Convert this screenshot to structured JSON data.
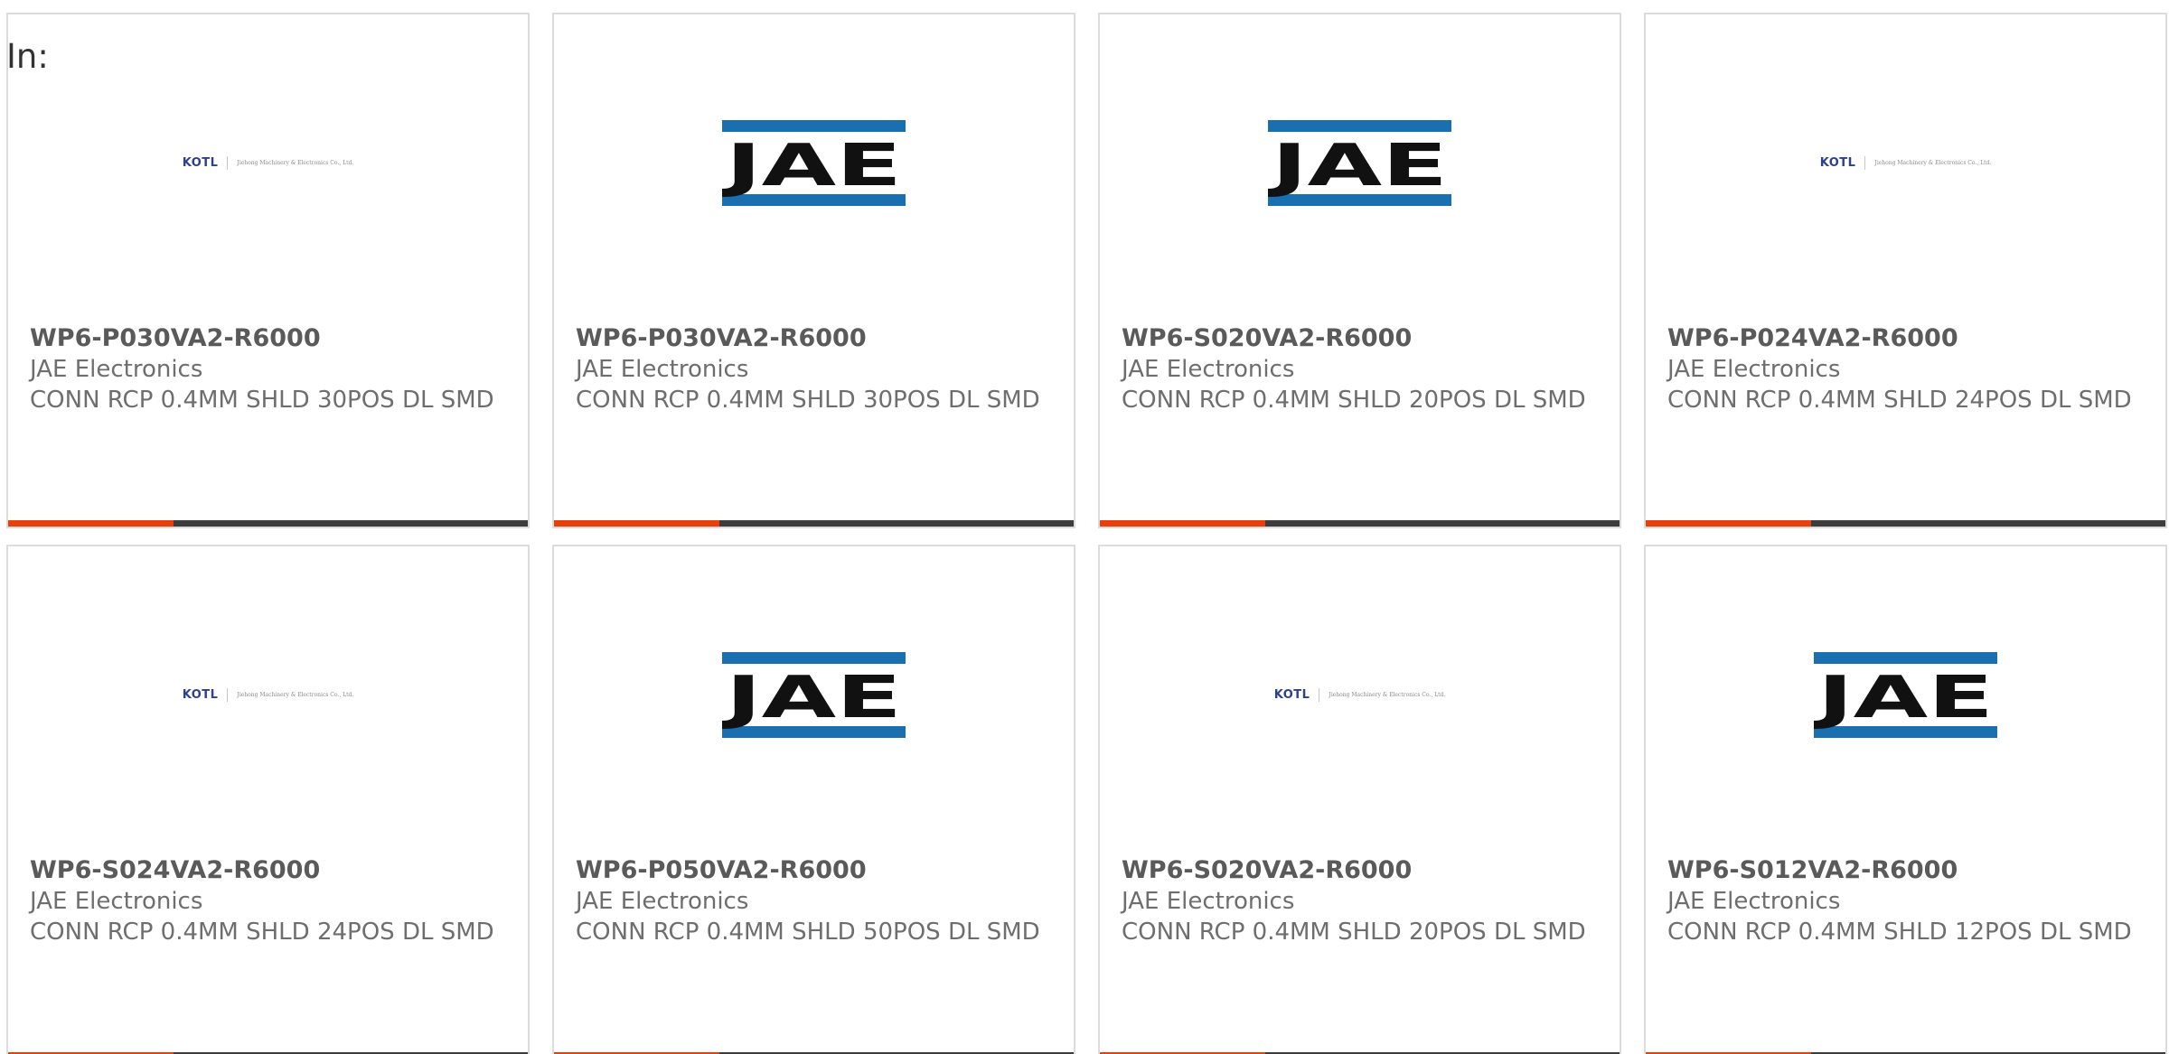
{
  "filter": {
    "label": "In:"
  },
  "colors": {
    "accent": "#e8400c",
    "bar_dark": "#3c3c3c",
    "jae_blue": "#1a6fb0",
    "jae_black": "#111111",
    "kotl_blue": "#2d3f8f",
    "kotl_red": "#d23a2a"
  },
  "kotl": {
    "mark": "KOTL",
    "company": "Jiehong Machinery & Electronics Co., Ltd."
  },
  "jae": {
    "mark": "JAE"
  },
  "products": [
    {
      "part": "WP6-P030VA2-R6000",
      "maker": "JAE Electronics",
      "desc": "CONN RCP 0.4MM SHLD 30POS DL SMD",
      "logo": "kotl"
    },
    {
      "part": "WP6-P030VA2-R6000",
      "maker": "JAE Electronics",
      "desc": "CONN RCP 0.4MM SHLD 30POS DL SMD",
      "logo": "jae"
    },
    {
      "part": "WP6-S020VA2-R6000",
      "maker": "JAE Electronics",
      "desc": "CONN RCP 0.4MM SHLD 20POS DL SMD",
      "logo": "jae"
    },
    {
      "part": "WP6-P024VA2-R6000",
      "maker": "JAE Electronics",
      "desc": "CONN RCP 0.4MM SHLD 24POS DL SMD",
      "logo": "kotl"
    },
    {
      "part": "WP6-S024VA2-R6000",
      "maker": "JAE Electronics",
      "desc": "CONN RCP 0.4MM SHLD 24POS DL SMD",
      "logo": "kotl"
    },
    {
      "part": "WP6-P050VA2-R6000",
      "maker": "JAE Electronics",
      "desc": "CONN RCP 0.4MM SHLD 50POS DL SMD",
      "logo": "jae"
    },
    {
      "part": "WP6-S020VA2-R6000",
      "maker": "JAE Electronics",
      "desc": "CONN RCP 0.4MM SHLD 20POS DL SMD",
      "logo": "kotl"
    },
    {
      "part": "WP6-S012VA2-R6000",
      "maker": "JAE Electronics",
      "desc": "CONN RCP 0.4MM SHLD 12POS DL SMD",
      "logo": "jae"
    }
  ]
}
